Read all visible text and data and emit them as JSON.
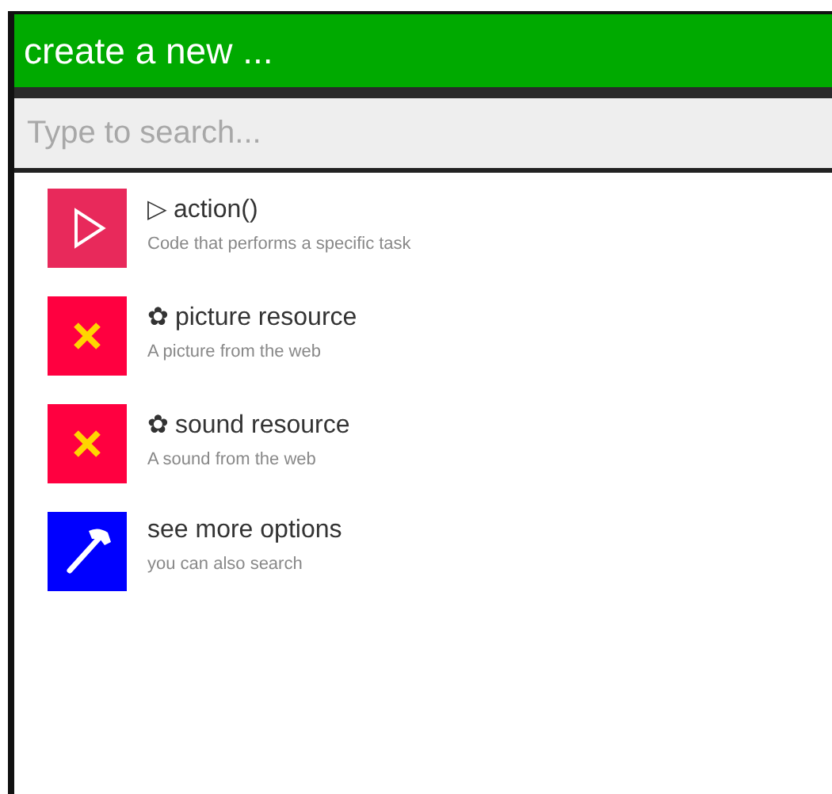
{
  "header": {
    "title": "create a new ..."
  },
  "search": {
    "placeholder": "Type to search..."
  },
  "items": [
    {
      "kind": "play",
      "color": "#e8295b",
      "title": "▷ action()",
      "subtitle": "Code that performs a specific task"
    },
    {
      "kind": "cross",
      "color": "#ff0040",
      "title": "✿ picture resource",
      "subtitle": "A picture from the web"
    },
    {
      "kind": "cross",
      "color": "#ff0040",
      "title": "✿ sound resource",
      "subtitle": "A sound from the web"
    },
    {
      "kind": "hammer",
      "color": "#0000ff",
      "title": "see more options",
      "subtitle": "you can also search"
    }
  ]
}
